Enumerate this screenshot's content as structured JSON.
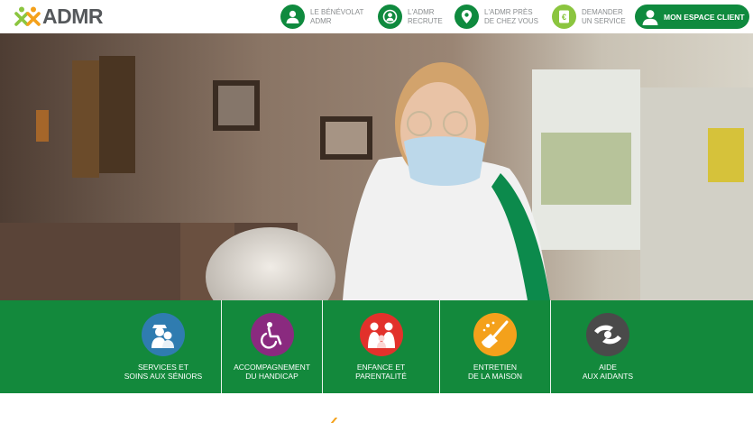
{
  "brand": {
    "name": "ADMR",
    "colors": {
      "green": "#13893c",
      "orange": "#f4a11b",
      "grey": "#55585b"
    }
  },
  "header": {
    "nav": [
      {
        "line1": "LE BÉNÉVOLAT",
        "line2": "ADMR",
        "icon": "volunteer-icon",
        "color": "#0f8a3e"
      },
      {
        "line1": "L'ADMR",
        "line2": "RECRUTE",
        "icon": "recruit-icon",
        "color": "#0f8a3e"
      },
      {
        "line1": "L'ADMR PRÈS",
        "line2": "DE CHEZ VOUS",
        "icon": "location-pin-icon",
        "color": "#0f8a3e"
      },
      {
        "line1": "DEMANDER",
        "line2": "UN SERVICE",
        "icon": "service-request-icon",
        "color": "#8bc53f"
      }
    ],
    "client_button": "MON ESPACE CLIENT"
  },
  "services": [
    {
      "line1": "SERVICES ET",
      "line2": "SOINS AUX SÉNIORS",
      "icon": "seniors-icon",
      "color": "#2f7cb0"
    },
    {
      "line1": "ACCOMPAGNEMENT",
      "line2": "DU HANDICAP",
      "icon": "wheelchair-icon",
      "color": "#8a2a7f"
    },
    {
      "line1": "ENFANCE ET",
      "line2": "PARENTALITÉ",
      "icon": "family-icon",
      "color": "#e2312b"
    },
    {
      "line1": "ENTRETIEN",
      "line2": "DE LA MAISON",
      "icon": "broom-icon",
      "color": "#f4a11b"
    },
    {
      "line1": "AIDE",
      "line2": "AUX AIDANTS",
      "icon": "caregiver-hands-icon",
      "color": "#4a4a4a"
    }
  ]
}
